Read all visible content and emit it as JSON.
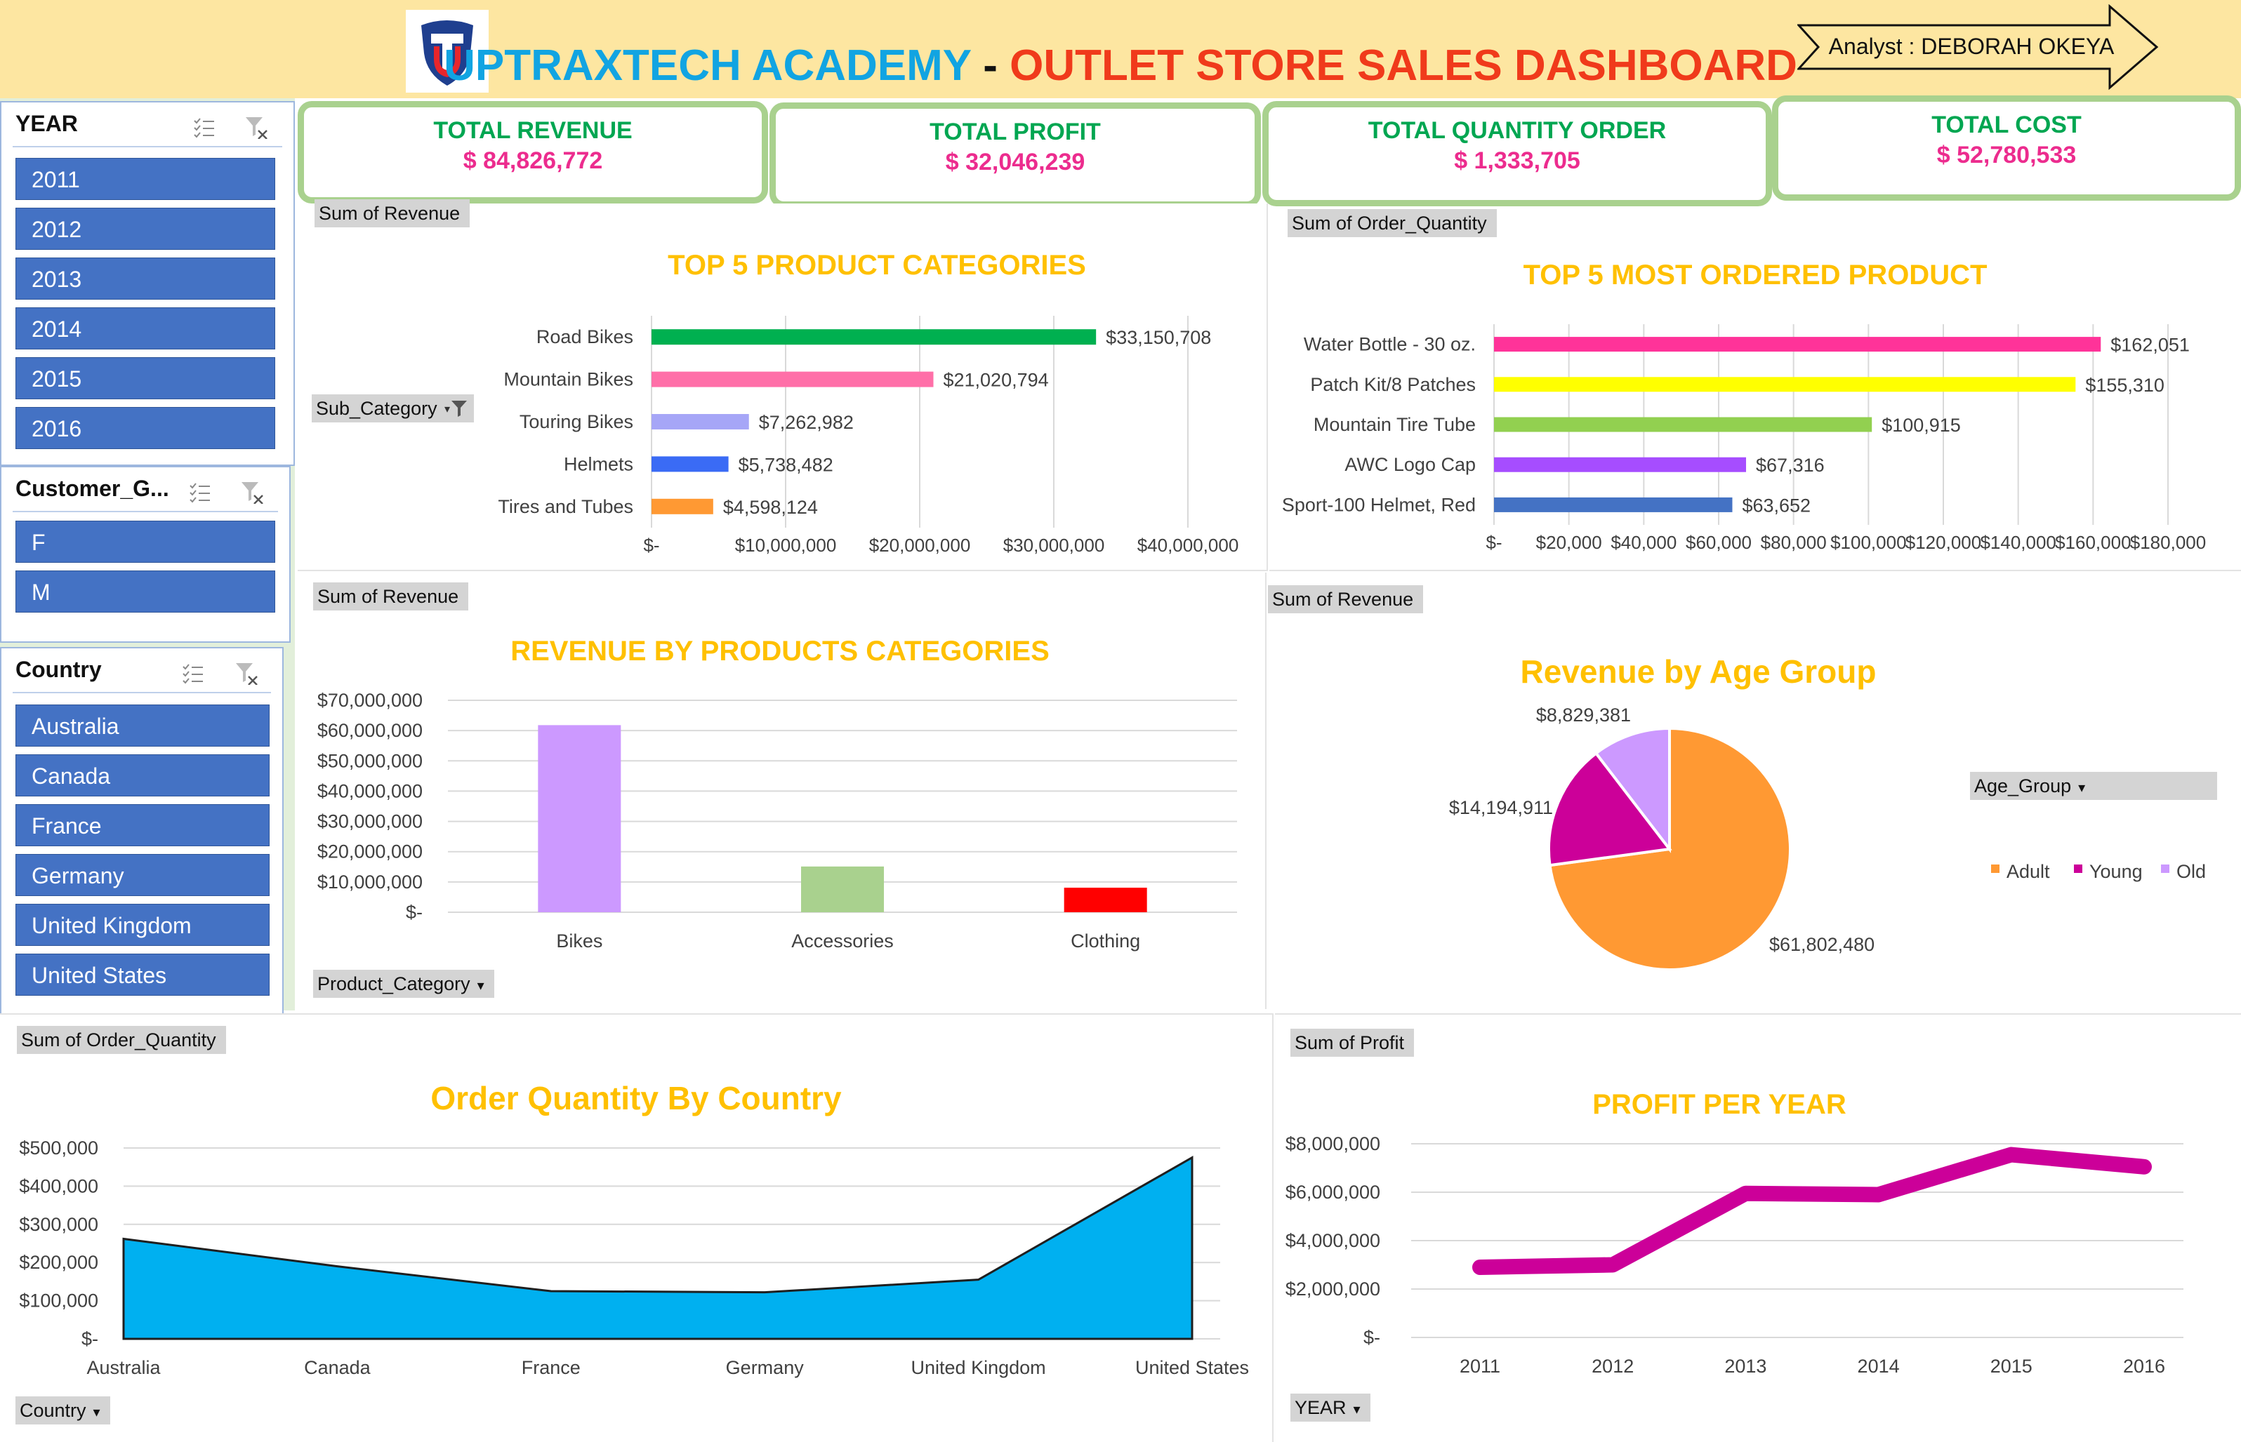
{
  "header": {
    "title_part1": "UPTRAXTECH ACADEMY",
    "title_sep": " - ",
    "title_part2": "OUTLET STORE SALES DASHBOARD",
    "analyst": "Analyst : DEBORAH OKEYA",
    "colors": {
      "bg": "#FDE6A1",
      "title1": "#11A4E2",
      "title2": "#F03A1B"
    }
  },
  "kpis": [
    {
      "label": "TOTAL REVENUE",
      "value": "$ 84,826,772"
    },
    {
      "label": "TOTAL PROFIT",
      "value": "$ 32,046,239"
    },
    {
      "label": "TOTAL QUANTITY ORDER",
      "value": "$ 1,333,705"
    },
    {
      "label": "TOTAL COST",
      "value": "$ 52,780,533"
    }
  ],
  "slicers": {
    "year": {
      "title": "YEAR",
      "items": [
        "2011",
        "2012",
        "2013",
        "2014",
        "2015",
        "2016"
      ]
    },
    "gender": {
      "title": "Customer_G...",
      "items": [
        "F",
        "M"
      ]
    },
    "country": {
      "title": "Country",
      "items": [
        "Australia",
        "Canada",
        "France",
        "Germany",
        "United Kingdom",
        "United States"
      ]
    }
  },
  "fields": {
    "sum_revenue": "Sum of Revenue",
    "sum_order_qty": "Sum of Order_Quantity",
    "sum_profit": "Sum of Profit",
    "sub_category": "Sub_Category",
    "product_category": "Product_Category",
    "age_group": "Age_Group",
    "country": "Country",
    "year": "YEAR"
  },
  "chart_data": [
    {
      "id": "top5_categories",
      "type": "bar",
      "orientation": "horizontal",
      "title": "TOP 5 PRODUCT CATEGORIES",
      "categories": [
        "Road Bikes",
        "Mountain Bikes",
        "Touring Bikes",
        "Helmets",
        "Tires and Tubes"
      ],
      "values": [
        33150708,
        21020794,
        7262982,
        5738482,
        4598124
      ],
      "data_labels": [
        "$33,150,708",
        "$21,020,794",
        "$7,262,982",
        "$5,738,482",
        "$4,598,124"
      ],
      "colors": [
        "#00B050",
        "#FF6FA8",
        "#A6A6F7",
        "#3A6BF5",
        "#FF9933"
      ],
      "xlim": [
        0,
        40000000
      ],
      "x_ticks": [
        "$-",
        "$10,000,000",
        "$20,000,000",
        "$30,000,000",
        "$40,000,000"
      ],
      "grid": true
    },
    {
      "id": "top5_ordered",
      "type": "bar",
      "orientation": "horizontal",
      "title": "TOP 5 MOST ORDERED PRODUCT",
      "categories": [
        "Water Bottle - 30 oz.",
        "Patch Kit/8 Patches",
        "Mountain Tire Tube",
        "AWC Logo Cap",
        "Sport-100 Helmet, Red"
      ],
      "values": [
        162051,
        155310,
        100915,
        67316,
        63652
      ],
      "data_labels": [
        "$162,051",
        "$155,310",
        "$100,915",
        "$67,316",
        "$63,652"
      ],
      "colors": [
        "#FF3399",
        "#FFFF00",
        "#92D050",
        "#A64DFF",
        "#4472C4"
      ],
      "xlim": [
        0,
        180000
      ],
      "x_ticks": [
        "$-",
        "$20,000",
        "$40,000",
        "$60,000",
        "$80,000",
        "$100,000",
        "$120,000",
        "$140,000",
        "$160,000",
        "$180,000"
      ],
      "grid": true
    },
    {
      "id": "revenue_by_category",
      "type": "bar",
      "title": "REVENUE BY PRODUCTS CATEGORIES",
      "categories": [
        "Bikes",
        "Accessories",
        "Clothing"
      ],
      "values": [
        61800000,
        15100000,
        8100000
      ],
      "colors": [
        "#CC99FF",
        "#A9D18E",
        "#FF0000"
      ],
      "ylim": [
        0,
        70000000
      ],
      "y_ticks": [
        "$-",
        "$10,000,000",
        "$20,000,000",
        "$30,000,000",
        "$40,000,000",
        "$50,000,000",
        "$60,000,000",
        "$70,000,000"
      ],
      "grid": true
    },
    {
      "id": "revenue_by_age",
      "type": "pie",
      "title": "Revenue by Age Group",
      "categories": [
        "Adult",
        "Young",
        "Old"
      ],
      "values": [
        61802480,
        14194911,
        8829381
      ],
      "data_labels": [
        "$61,802,480",
        "$14,194,911",
        "$8,829,381"
      ],
      "colors": [
        "#FF9933",
        "#CC0099",
        "#CC99FF"
      ],
      "legend": "right"
    },
    {
      "id": "order_qty_by_country",
      "type": "area",
      "title": "Order Quantity By Country",
      "categories": [
        "Australia",
        "Canada",
        "France",
        "Germany",
        "United Kingdom",
        "United States"
      ],
      "values": [
        262000,
        190000,
        125000,
        122000,
        155000,
        475000
      ],
      "color": "#00B0F0",
      "ylim": [
        0,
        500000
      ],
      "y_ticks": [
        "$-",
        "$100,000",
        "$200,000",
        "$300,000",
        "$400,000",
        "$500,000"
      ],
      "grid": true
    },
    {
      "id": "profit_per_year",
      "type": "line",
      "title": "PROFIT PER YEAR",
      "categories": [
        "2011",
        "2012",
        "2013",
        "2014",
        "2015",
        "2016"
      ],
      "values": [
        2900000,
        3000000,
        5950000,
        5900000,
        7550000,
        7050000
      ],
      "color": "#CC0099",
      "ylim": [
        0,
        8000000
      ],
      "y_ticks": [
        "$-",
        "$2,000,000",
        "$4,000,000",
        "$6,000,000",
        "$8,000,000"
      ],
      "grid": true
    }
  ]
}
